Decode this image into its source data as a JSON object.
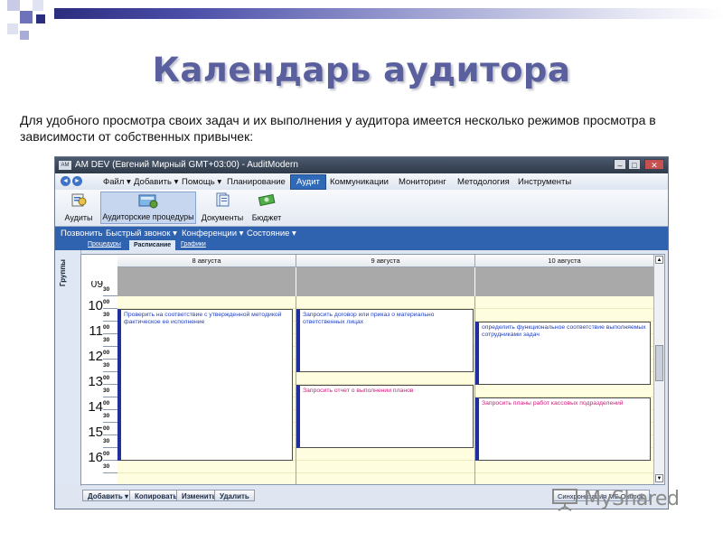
{
  "slide": {
    "title": "Календарь аудитора",
    "description": "Для удобного просмотра своих задач и их выполнения у аудитора имеется несколько режимов просмотра в зависимости от собственных привычек:"
  },
  "window": {
    "title": "AM DEV (Евгений Мирный GMT+03:00) - AuditModern",
    "app_icon_text": "AM",
    "minimize": "–",
    "maximize": "□",
    "close": "✕"
  },
  "menu": {
    "back": "◄",
    "forward": "►",
    "items": [
      "Файл ▾",
      "Добавить ▾",
      "Помощь ▾",
      "Планирование",
      "Аудит",
      "Коммуникации",
      "Мониторинг",
      "Методология",
      "Инструменты"
    ],
    "active_index": 4
  },
  "ribbon": {
    "buttons": [
      "Аудиты",
      "Аудиторские процедуры",
      "Документы",
      "Бюджет"
    ],
    "active_index": 1
  },
  "toolbar": {
    "items": [
      "Позвонить",
      "Быстрый звонок ▾",
      "Конференции ▾",
      "Состояние ▾"
    ]
  },
  "subtabs": {
    "items": [
      "Процедуры",
      "Расписание",
      "Графики"
    ],
    "active_index": 1
  },
  "sidebar": {
    "label": "Группы"
  },
  "calendar": {
    "days": [
      "8 августа",
      "9 августа",
      "10 августа"
    ],
    "hours": [
      "09",
      "10",
      "11",
      "12",
      "13",
      "14",
      "15",
      "16"
    ],
    "minutes": [
      "00",
      "30"
    ],
    "appointments": [
      {
        "text": "Проверить на соответствие с утвержденной методикой фактическое ее исполнение",
        "color": "#1f3ec0"
      },
      {
        "text": "Запросить договор или приказ о материально ответственных лицах",
        "color": "#1f3ec0"
      },
      {
        "text": "Запросить отчет  о выполнении планов",
        "color": "#d01a7a"
      },
      {
        "text": "определить функциональное соответствие выполняемых сотрудниками задач",
        "color": "#1f3ec0"
      },
      {
        "text": "Запросить планы работ кассовых подразделений",
        "color": "#d01a7a"
      }
    ],
    "scroll_up": "▲",
    "scroll_down": "▼"
  },
  "bottom": {
    "buttons": [
      "Добавить ▾",
      "Копировать",
      "Изменить",
      "Удалить"
    ],
    "sync": "Синхронизация MS Outlook"
  },
  "watermark": {
    "text": "MyShared"
  }
}
